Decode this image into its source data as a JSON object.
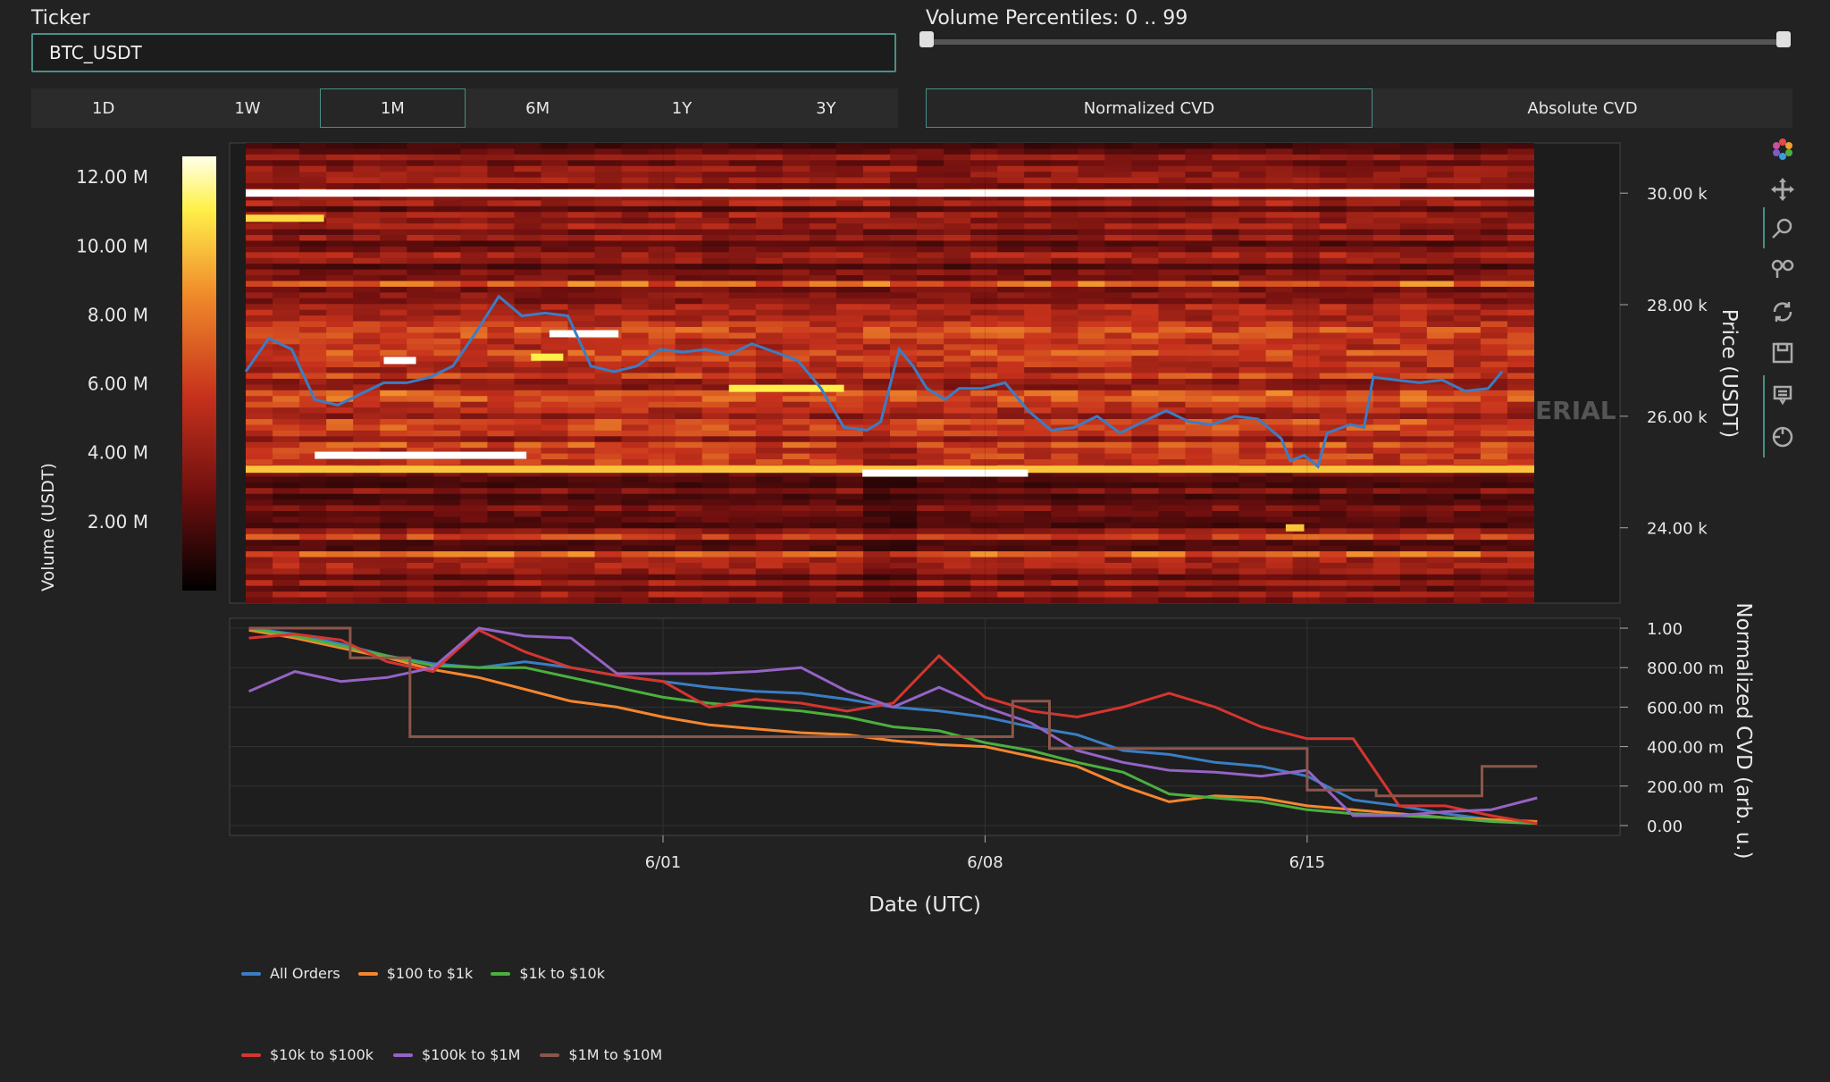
{
  "ticker": {
    "label": "Ticker",
    "value": "BTC_USDT"
  },
  "ranges": [
    "1D",
    "1W",
    "1M",
    "6M",
    "1Y",
    "3Y"
  ],
  "active_range": "1M",
  "volume_percentiles": {
    "label": "Volume Percentiles: 0 .. 99",
    "min": 0,
    "max": 99
  },
  "cvd_modes": [
    "Normalized CVD",
    "Absolute CVD"
  ],
  "active_cvd_mode": "Normalized CVD",
  "watermark": "ERIAL",
  "modebar_icons": [
    "plotly-logo-icon",
    "pan-icon",
    "zoom-icon",
    "autoscale-icon",
    "reset-axes-icon",
    "download-icon",
    "hover-compare-icon",
    "spike-lines-icon"
  ],
  "colors": {
    "price": "#3b7dc4",
    "accent": "#4a8f86",
    "background": "#222222"
  },
  "chart_data": [
    {
      "type": "heatmap",
      "title": "",
      "colorbar": {
        "title": "Volume (USDT)",
        "ticks": [
          "2.00 M",
          "4.00 M",
          "6.00 M",
          "8.00 M",
          "10.00 M",
          "12.00 M"
        ],
        "tick_values": [
          2000000,
          4000000,
          6000000,
          8000000,
          10000000,
          12000000
        ],
        "range": [
          0,
          12600000
        ],
        "colorscale": [
          "#000000",
          "#6e0f0f",
          "#c7321c",
          "#f08a2a",
          "#fff14a",
          "#ffffff"
        ]
      },
      "yaxis": {
        "label": "Price (USDT)",
        "side": "right",
        "ticks": [
          "24.00 k",
          "26.00 k",
          "28.00 k",
          "30.00 k"
        ],
        "tick_values": [
          24000,
          26000,
          28000,
          30000
        ],
        "range": [
          22650,
          30900
        ]
      },
      "x_range_days": [
        0,
        28
      ],
      "hot_levels": [
        {
          "price": 30000,
          "start": 0,
          "end": 28,
          "value": 12600000
        },
        {
          "price": 29550,
          "start": 0,
          "end": 1.7,
          "value": 9500000
        },
        {
          "price": 27000,
          "start": 3.0,
          "end": 3.7,
          "value": 12600000
        },
        {
          "price": 27480,
          "start": 6.6,
          "end": 8.1,
          "value": 12600000
        },
        {
          "price": 27060,
          "start": 6.2,
          "end": 6.9,
          "value": 10000000
        },
        {
          "price": 26500,
          "start": 10.5,
          "end": 13.0,
          "value": 10000000
        },
        {
          "price": 25300,
          "start": 1.5,
          "end": 6.1,
          "value": 12600000
        },
        {
          "price": 25050,
          "start": 0,
          "end": 28,
          "value": 9000000
        },
        {
          "price": 24980,
          "start": 13.4,
          "end": 17.0,
          "value": 12600000
        },
        {
          "price": 24000,
          "start": 22.6,
          "end": 23.0,
          "value": 9000000
        }
      ],
      "price_series": {
        "name": "Price",
        "x": [
          0,
          0.5,
          1.0,
          1.5,
          2.0,
          2.5,
          3.0,
          3.5,
          4.0,
          4.5,
          5.0,
          5.5,
          6.0,
          6.5,
          7.0,
          7.5,
          8.0,
          8.5,
          9.0,
          9.5,
          10.0,
          10.5,
          11.0,
          11.5,
          12.0,
          12.5,
          13.0,
          13.5,
          13.8,
          14.2,
          14.5,
          14.8,
          15.2,
          15.5,
          16.0,
          16.5,
          17.0,
          17.5,
          18.0,
          18.5,
          19.0,
          19.5,
          20.0,
          20.5,
          21.0,
          21.5,
          22.0,
          22.5,
          22.7,
          23.0,
          23.3,
          23.5,
          24.0,
          24.3,
          24.5,
          25.0,
          25.5,
          26.0,
          26.5,
          27.0,
          27.3
        ],
        "y": [
          26800,
          27400,
          27200,
          26300,
          26200,
          26400,
          26600,
          26600,
          26700,
          26900,
          27500,
          28150,
          27800,
          27850,
          27800,
          26900,
          26800,
          26900,
          27200,
          27150,
          27200,
          27100,
          27300,
          27150,
          27000,
          26500,
          25800,
          25750,
          25900,
          27200,
          26900,
          26500,
          26300,
          26500,
          26500,
          26600,
          26100,
          25750,
          25800,
          26000,
          25700,
          25900,
          26100,
          25900,
          25850,
          26000,
          25950,
          25600,
          25200,
          25300,
          25100,
          25700,
          25850,
          25800,
          26700,
          26650,
          26600,
          26650,
          26450,
          26500,
          26800
        ]
      }
    },
    {
      "type": "line",
      "title": "",
      "xlabel": "Date (UTC)",
      "ylabel": "Normalized CVD (arb. u.)",
      "x_ticks": [
        "6/01",
        "6/08",
        "6/15"
      ],
      "x_tick_values": [
        9,
        16,
        23
      ],
      "x_range": [
        -0.4,
        29.8
      ],
      "ylim": [
        -0.05,
        1.05
      ],
      "y_ticks": [
        "0.00",
        "200.00 m",
        "400.00 m",
        "600.00 m",
        "800.00 m",
        "1.00"
      ],
      "y_tick_values": [
        0,
        0.2,
        0.4,
        0.6,
        0.8,
        1.0
      ],
      "legend_position": "bottom-left",
      "series": [
        {
          "name": "All Orders",
          "color": "#3b7dc4",
          "x": [
            0,
            1,
            2,
            3,
            4,
            5,
            6,
            7,
            8,
            9,
            10,
            11,
            12,
            13,
            14,
            15,
            16,
            17,
            18,
            19,
            20,
            21,
            22,
            23,
            24,
            25,
            26,
            27,
            28
          ],
          "y": [
            1.0,
            0.97,
            0.92,
            0.86,
            0.82,
            0.8,
            0.83,
            0.8,
            0.76,
            0.73,
            0.7,
            0.68,
            0.67,
            0.64,
            0.6,
            0.58,
            0.55,
            0.5,
            0.46,
            0.38,
            0.36,
            0.32,
            0.3,
            0.25,
            0.13,
            0.1,
            0.06,
            0.03,
            0.02
          ]
        },
        {
          "name": "$100 to $1k",
          "color": "#f5862f",
          "x": [
            0,
            1,
            2,
            3,
            4,
            5,
            6,
            7,
            8,
            9,
            10,
            11,
            12,
            13,
            14,
            15,
            16,
            17,
            18,
            19,
            20,
            21,
            22,
            23,
            24,
            25,
            26,
            27,
            28
          ],
          "y": [
            0.99,
            0.95,
            0.9,
            0.85,
            0.79,
            0.75,
            0.69,
            0.63,
            0.6,
            0.55,
            0.51,
            0.49,
            0.47,
            0.46,
            0.43,
            0.41,
            0.4,
            0.35,
            0.3,
            0.2,
            0.12,
            0.15,
            0.14,
            0.1,
            0.08,
            0.06,
            0.04,
            0.03,
            0.02
          ]
        },
        {
          "name": "$1k to $10k",
          "color": "#4caf3f",
          "x": [
            0,
            1,
            2,
            3,
            4,
            5,
            6,
            7,
            8,
            9,
            10,
            11,
            12,
            13,
            14,
            15,
            16,
            17,
            18,
            19,
            20,
            21,
            22,
            23,
            24,
            25,
            26,
            27,
            28
          ],
          "y": [
            1.0,
            0.96,
            0.91,
            0.86,
            0.81,
            0.8,
            0.8,
            0.75,
            0.7,
            0.65,
            0.62,
            0.6,
            0.58,
            0.55,
            0.5,
            0.48,
            0.42,
            0.38,
            0.32,
            0.27,
            0.16,
            0.14,
            0.12,
            0.08,
            0.06,
            0.05,
            0.04,
            0.02,
            0.01
          ]
        },
        {
          "name": "$10k to $100k",
          "color": "#d6352f",
          "x": [
            0,
            1,
            2,
            3,
            4,
            5,
            6,
            7,
            8,
            9,
            10,
            11,
            12,
            13,
            14,
            15,
            16,
            17,
            18,
            19,
            20,
            21,
            22,
            23,
            24,
            25,
            26,
            27,
            28
          ],
          "y": [
            0.95,
            0.97,
            0.94,
            0.83,
            0.78,
            0.99,
            0.88,
            0.8,
            0.76,
            0.73,
            0.6,
            0.64,
            0.62,
            0.58,
            0.62,
            0.86,
            0.65,
            0.58,
            0.55,
            0.6,
            0.67,
            0.6,
            0.5,
            0.44,
            0.44,
            0.1,
            0.1,
            0.05,
            0.01
          ]
        },
        {
          "name": "$100k to $1M",
          "color": "#9563c5",
          "x": [
            0,
            1,
            2,
            3,
            4,
            5,
            6,
            7,
            8,
            9,
            10,
            11,
            12,
            13,
            14,
            15,
            16,
            17,
            18,
            19,
            20,
            21,
            22,
            23,
            24,
            25,
            26,
            27,
            28
          ],
          "y": [
            0.68,
            0.78,
            0.73,
            0.75,
            0.8,
            1.0,
            0.96,
            0.95,
            0.77,
            0.77,
            0.77,
            0.78,
            0.8,
            0.68,
            0.6,
            0.7,
            0.6,
            0.52,
            0.38,
            0.32,
            0.28,
            0.27,
            0.25,
            0.28,
            0.05,
            0.05,
            0.07,
            0.08,
            0.14
          ]
        },
        {
          "name": "$1M to $10M",
          "color": "#8c564b",
          "x": [
            0,
            2.2,
            2.2,
            3.5,
            3.5,
            16.6,
            16.6,
            17.4,
            17.4,
            23.0,
            23.0,
            24.5,
            24.5,
            26.8,
            26.8,
            28.0
          ],
          "y": [
            1.0,
            1.0,
            0.85,
            0.85,
            0.45,
            0.45,
            0.63,
            0.63,
            0.39,
            0.39,
            0.18,
            0.18,
            0.15,
            0.15,
            0.3,
            0.3
          ]
        }
      ]
    }
  ]
}
